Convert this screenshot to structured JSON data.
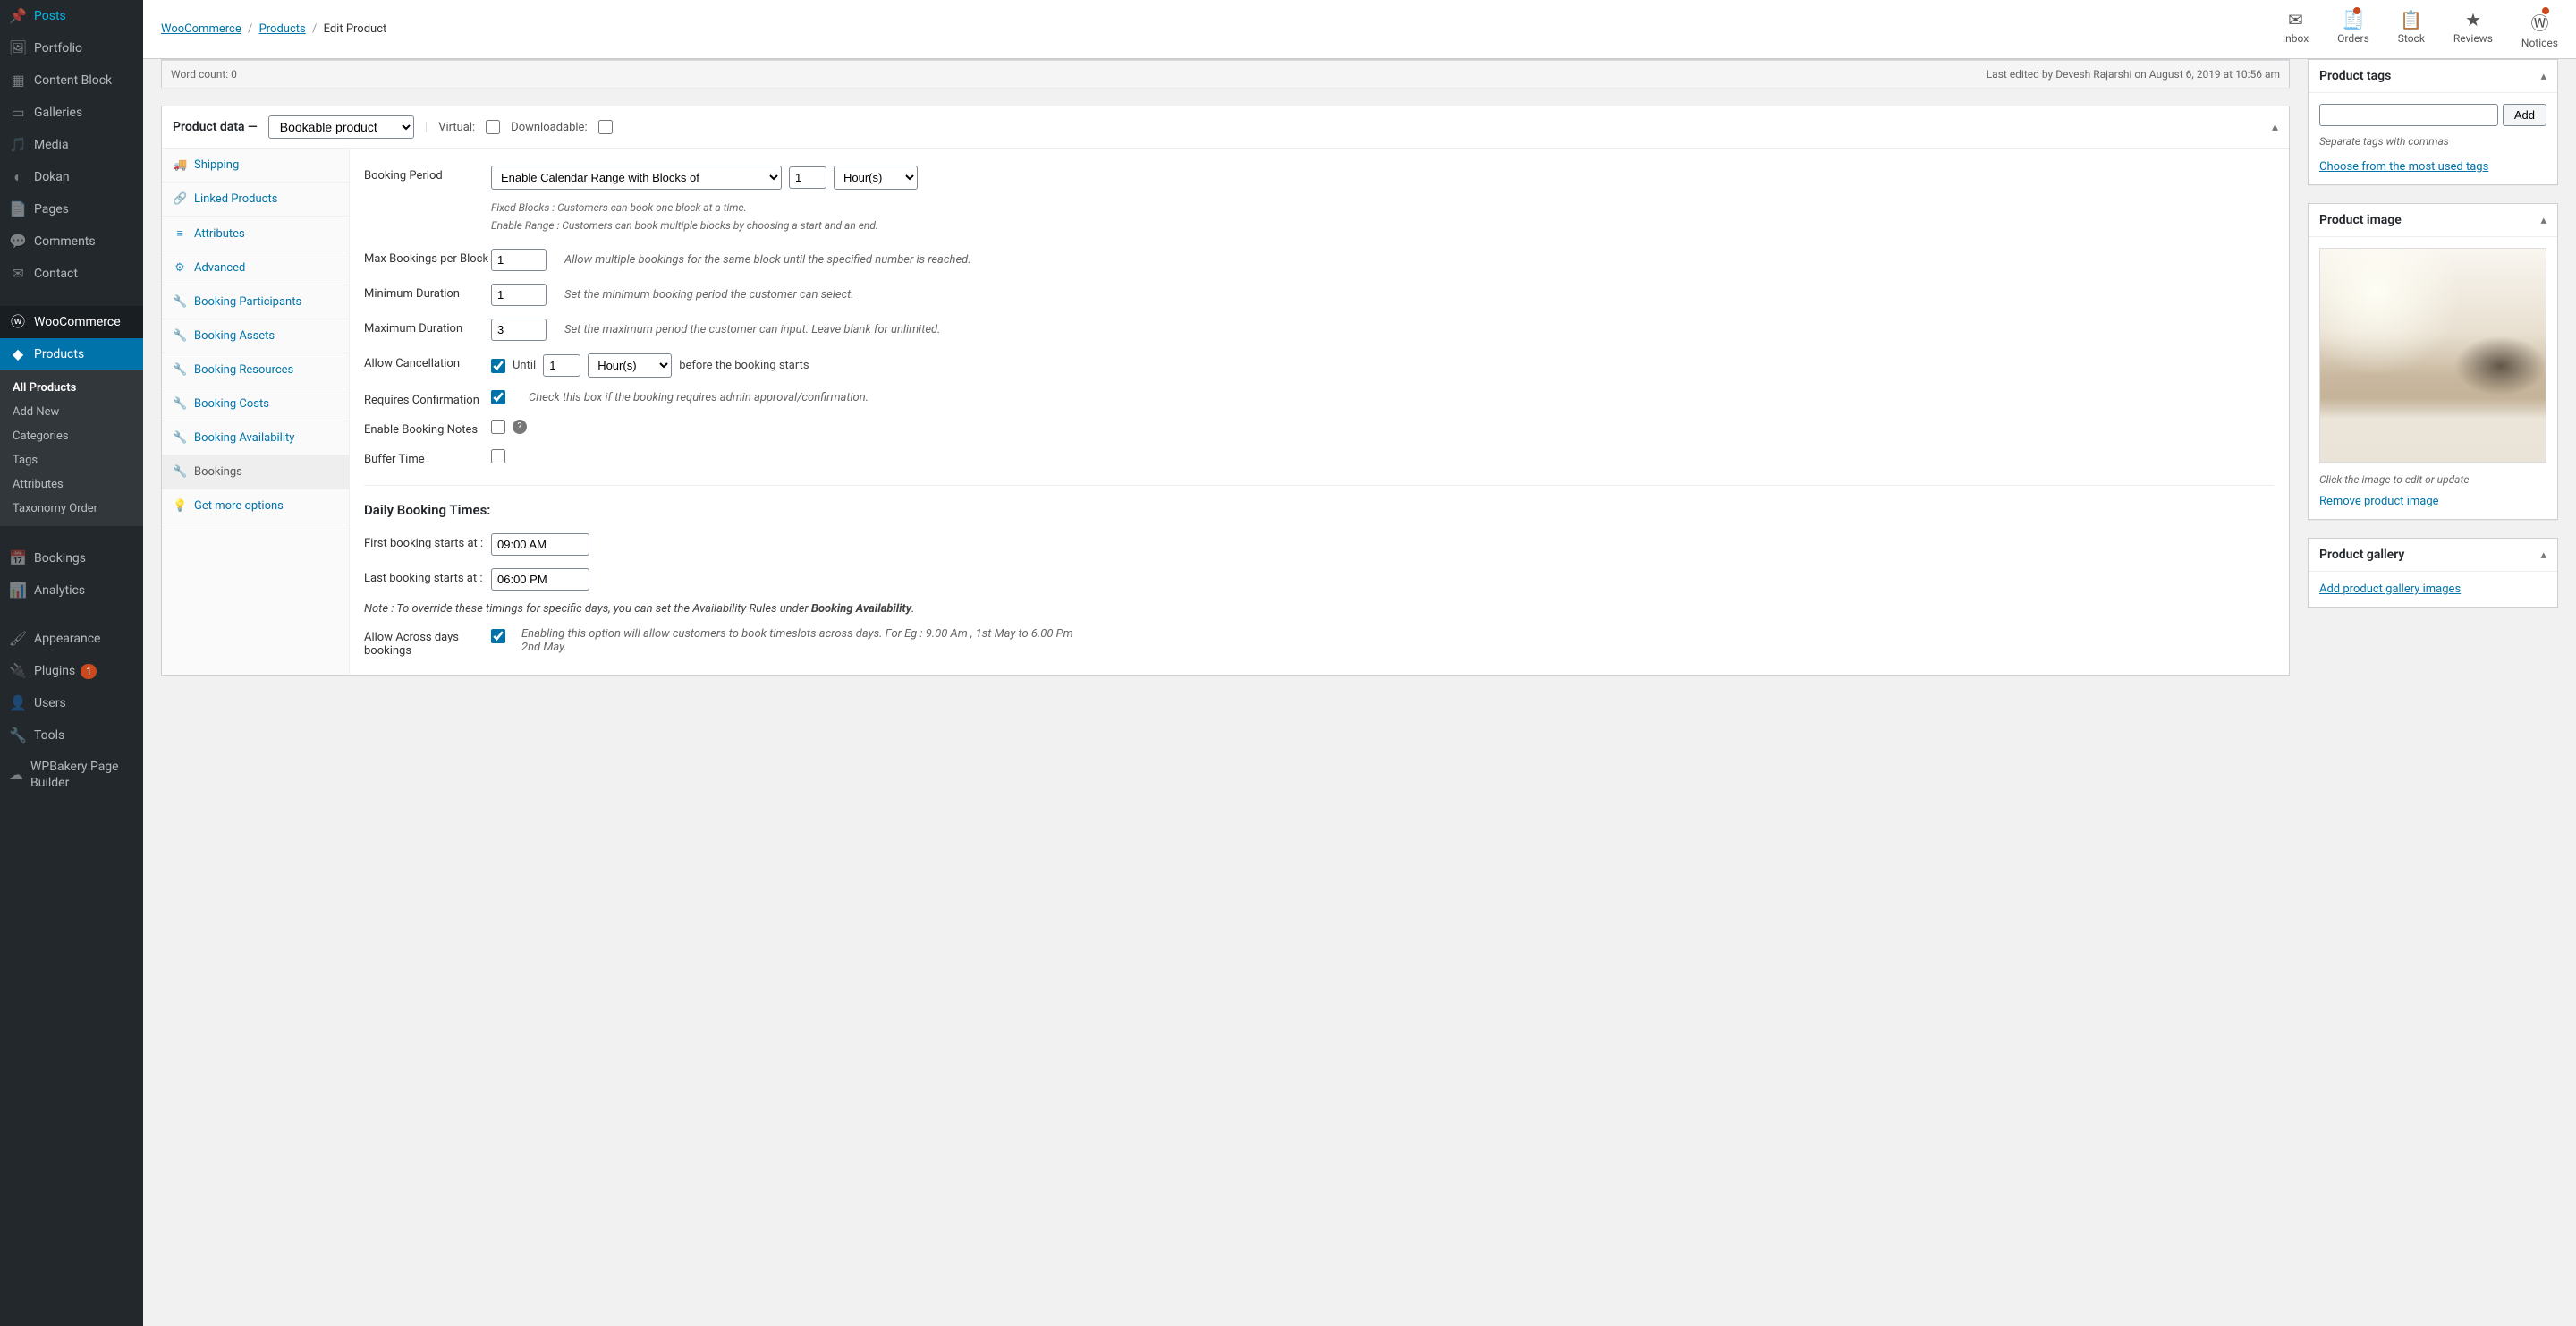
{
  "sidebar": {
    "items": [
      {
        "icon": "📌",
        "label": "Posts"
      },
      {
        "icon": "🖼",
        "label": "Portfolio"
      },
      {
        "icon": "▦",
        "label": "Content Block"
      },
      {
        "icon": "▭",
        "label": "Galleries"
      },
      {
        "icon": "🎵",
        "label": "Media"
      },
      {
        "icon": "◐",
        "label": "Dokan"
      },
      {
        "icon": "📄",
        "label": "Pages"
      },
      {
        "icon": "💬",
        "label": "Comments"
      },
      {
        "icon": "✉",
        "label": "Contact"
      },
      {
        "icon": "ⓦ",
        "label": "WooCommerce",
        "open": true
      },
      {
        "icon": "◆",
        "label": "Products",
        "current": true
      },
      {
        "icon": "📅",
        "label": "Bookings"
      },
      {
        "icon": "📊",
        "label": "Analytics"
      },
      {
        "icon": "🖌",
        "label": "Appearance"
      },
      {
        "icon": "🔌",
        "label": "Plugins",
        "badge": "1"
      },
      {
        "icon": "👤",
        "label": "Users"
      },
      {
        "icon": "🔧",
        "label": "Tools"
      },
      {
        "icon": "☁",
        "label": "WPBakery Page Builder"
      }
    ],
    "submenu": [
      "All Products",
      "Add New",
      "Categories",
      "Tags",
      "Attributes",
      "Taxonomy Order"
    ]
  },
  "breadcrumb": {
    "root": "WooCommerce",
    "mid": "Products",
    "leaf": "Edit Product"
  },
  "headerIcons": [
    {
      "glyph": "✉",
      "label": "Inbox"
    },
    {
      "glyph": "🧾",
      "label": "Orders",
      "dot": true
    },
    {
      "glyph": "📋",
      "label": "Stock"
    },
    {
      "glyph": "★",
      "label": "Reviews"
    },
    {
      "glyph": "Ⓦ",
      "label": "Notices",
      "dot": true
    }
  ],
  "status": {
    "wordcount": "Word count: 0",
    "lastedit": "Last edited by Devesh Rajarshi on August 6, 2019 at 10:56 am"
  },
  "productData": {
    "title": "Product data —",
    "type": "Bookable product",
    "virtual": "Virtual:",
    "downloadable": "Downloadable:"
  },
  "tabs": [
    "Shipping",
    "Linked Products",
    "Attributes",
    "Advanced",
    "Booking Participants",
    "Booking Assets",
    "Booking Resources",
    "Booking Costs",
    "Booking Availability",
    "Bookings",
    "Get more options"
  ],
  "tabIcons": [
    "🚚",
    "🔗",
    "≡",
    "⚙",
    "🔧",
    "🔧",
    "🔧",
    "🔧",
    "🔧",
    "🔧",
    "💡"
  ],
  "form": {
    "bookingPeriod": {
      "label": "Booking Period",
      "select": "Enable Calendar Range with Blocks of",
      "num": "1",
      "unit": "Hour(s)",
      "hint1": "Fixed Blocks : Customers can book one block at a time.",
      "hint2": "Enable Range : Customers can book multiple blocks by choosing a start and an end."
    },
    "maxBookings": {
      "label": "Max Bookings per Block",
      "val": "1",
      "hint": "Allow multiple bookings for the same block until the specified number is reached."
    },
    "minDuration": {
      "label": "Minimum Duration",
      "val": "1",
      "hint": "Set the minimum booking period the customer can select."
    },
    "maxDuration": {
      "label": "Maximum Duration",
      "val": "3",
      "hint": "Set the maximum period the customer can input. Leave blank for unlimited."
    },
    "allowCancel": {
      "label": "Allow Cancellation",
      "until": "Until",
      "val": "1",
      "unit": "Hour(s)",
      "after": "before the booking starts"
    },
    "requiresConfirm": {
      "label": "Requires Confirmation",
      "hint": "Check this box if the booking requires admin approval/confirmation."
    },
    "bookingNotes": {
      "label": "Enable Booking Notes"
    },
    "bufferTime": {
      "label": "Buffer Time"
    },
    "dailyTitle": "Daily Booking Times:",
    "firstBooking": {
      "label": "First booking starts at :",
      "val": "09:00 AM"
    },
    "lastBooking": {
      "label": "Last booking starts at :",
      "val": "06:00 PM"
    },
    "note": {
      "pre": "Note : To override these timings for specific days, you can set the Availability Rules under ",
      "strong": "Booking Availability",
      "post": "."
    },
    "acrossDays": {
      "label": "Allow Across days bookings",
      "hint": "Enabling this option will allow customers to book timeslots across days. For Eg : 9.00 Am , 1st May to 6.00 Pm 2nd May."
    }
  },
  "tags": {
    "title": "Product tags",
    "add": "Add",
    "hint": "Separate tags with commas",
    "link": "Choose from the most used tags"
  },
  "image": {
    "title": "Product image",
    "hint": "Click the image to edit or update",
    "remove": "Remove product image"
  },
  "gallery": {
    "title": "Product gallery",
    "link": "Add product gallery images"
  }
}
